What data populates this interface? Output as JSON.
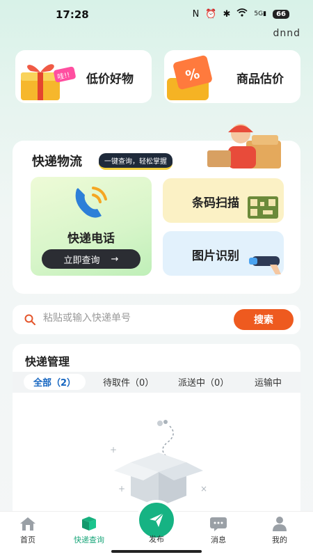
{
  "status_bar": {
    "time": "17:28",
    "icons": [
      "nfc-icon",
      "alarm-icon",
      "bluetooth-icon",
      "wifi-icon",
      "signal-icon"
    ],
    "network": "5G",
    "battery": "66"
  },
  "user": {
    "name": "dnnd"
  },
  "promos": [
    {
      "label": "低价好物",
      "tag": "哇!!"
    },
    {
      "label": "商品估价",
      "symbol": "%"
    }
  ],
  "logistics": {
    "title": "快递物流",
    "badge": "一键查询，轻松掌握",
    "phone_card": {
      "label": "快递电话",
      "button": "立即查询",
      "arrow": "→"
    },
    "scan_card": {
      "label": "条码扫描"
    },
    "ocr_card": {
      "label": "图片识别"
    }
  },
  "search": {
    "placeholder": "粘贴或输入快递单号",
    "button": "搜索"
  },
  "manage": {
    "title": "快递管理",
    "tabs": [
      {
        "label": "全部（2）",
        "active": true
      },
      {
        "label": "待取件（0）",
        "active": false
      },
      {
        "label": "派送中（0）",
        "active": false
      },
      {
        "label": "运输中",
        "active": false
      }
    ]
  },
  "bottom_nav": {
    "items": [
      {
        "label": "首页",
        "icon": "home-icon",
        "active": false
      },
      {
        "label": "快递查询",
        "icon": "box-icon",
        "active": true
      },
      {
        "label": "发布",
        "icon": "paper-plane-icon",
        "active": false
      },
      {
        "label": "消息",
        "icon": "message-icon",
        "active": false
      },
      {
        "label": "我的",
        "icon": "user-icon",
        "active": false
      }
    ]
  },
  "colors": {
    "accent_green": "#16b383",
    "search_orange": "#ee5a1f",
    "active_tab_blue": "#1565c0"
  }
}
